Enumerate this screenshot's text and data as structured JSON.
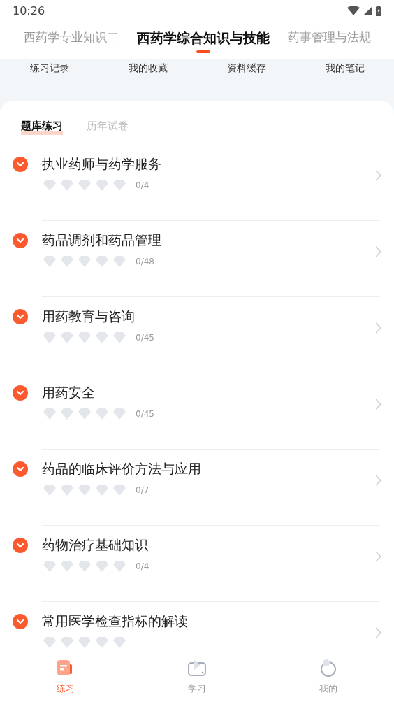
{
  "status_bar": {
    "time": "10:26"
  },
  "subject_tabs": [
    {
      "label": "西药学专业知识二",
      "selected": false
    },
    {
      "label": "西药学综合知识与技能",
      "selected": true
    },
    {
      "label": "药事管理与法规",
      "selected": false
    }
  ],
  "shortcuts": [
    "练习记录",
    "我的收藏",
    "资料缓存",
    "我的笔记"
  ],
  "sub_tabs": [
    {
      "label": "题库练习",
      "selected": true
    },
    {
      "label": "历年试卷",
      "selected": false
    }
  ],
  "chapters": [
    {
      "title": "执业药师与药学服务",
      "stars": 0,
      "count": "0/4"
    },
    {
      "title": "药品调剂和药品管理",
      "stars": 0,
      "count": "0/48"
    },
    {
      "title": "用药教育与咨询",
      "stars": 0,
      "count": "0/45"
    },
    {
      "title": "用药安全",
      "stars": 0,
      "count": "0/45"
    },
    {
      "title": "药品的临床评价方法与应用",
      "stars": 0,
      "count": "0/7"
    },
    {
      "title": "药物治疗基础知识",
      "stars": 0,
      "count": "0/4"
    },
    {
      "title": "常用医学检查指标的解读",
      "stars": 0
    }
  ],
  "bottom_nav": [
    {
      "label": "练习",
      "kind": "practice",
      "selected": true
    },
    {
      "label": "学习",
      "kind": "study",
      "selected": false
    },
    {
      "label": "我的",
      "kind": "profile",
      "selected": false
    }
  ]
}
